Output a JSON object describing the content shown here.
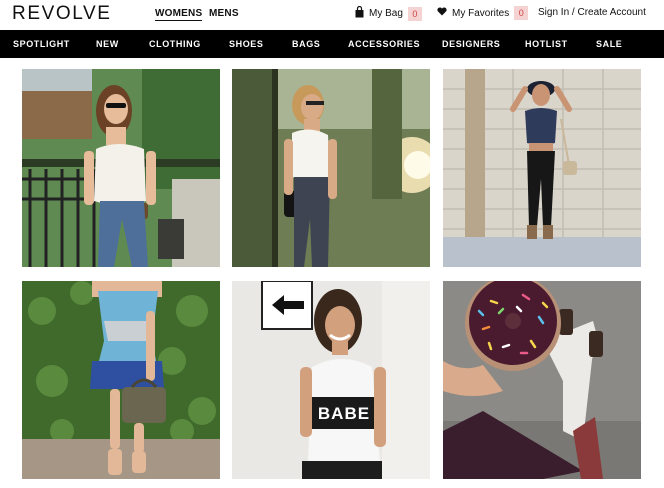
{
  "header": {
    "logo": "REVOLVE",
    "womens": "WOMENS",
    "mens": "MENS",
    "bag_label": "My Bag",
    "bag_count": "0",
    "favorites_label": "My Favorites",
    "favorites_count": "0",
    "signin_label": "Sign In / Create Account"
  },
  "nav": {
    "items": [
      "SPOTLIGHT",
      "NEW",
      "CLOTHING",
      "SHOES",
      "BAGS",
      "ACCESSORIES",
      "DESIGNERS",
      "HOTLIST",
      "SALE"
    ]
  },
  "gallery": {
    "photo5_text": "BABE"
  },
  "colors": {
    "nav_bg": "#000000",
    "count_bg": "#f6d3d3"
  }
}
